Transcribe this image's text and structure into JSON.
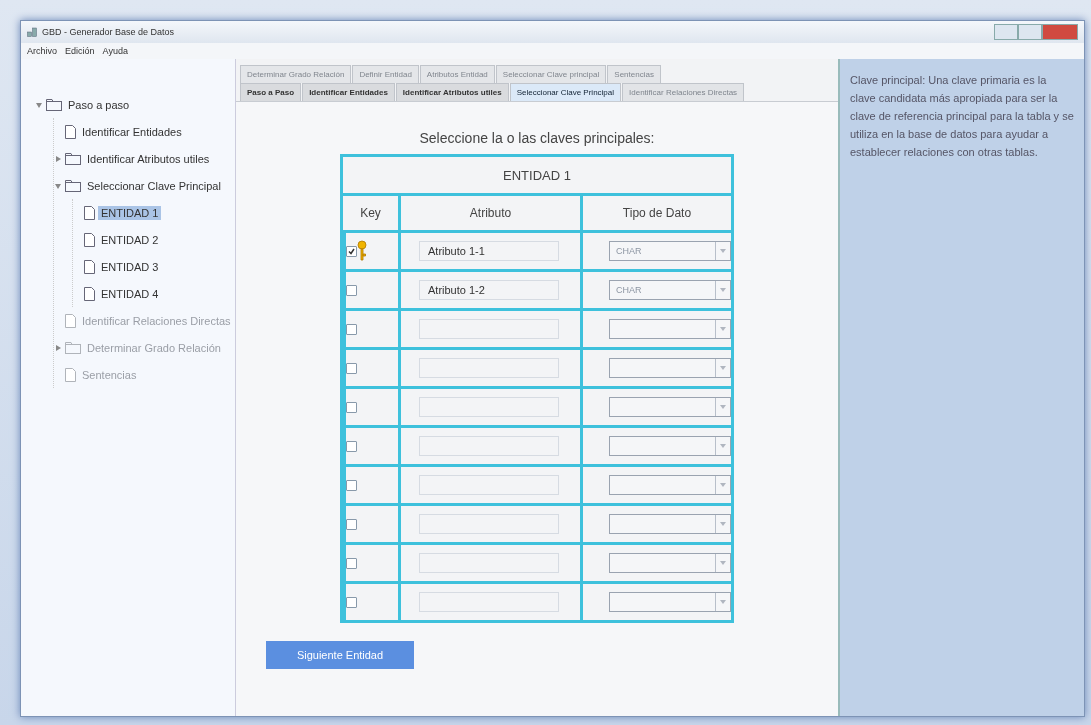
{
  "window": {
    "title": "GBD - Generador Base de Datos"
  },
  "menu": [
    "Archivo",
    "Edición",
    "Ayuda"
  ],
  "tree": [
    {
      "label": "Paso a paso",
      "kind": "folder",
      "expanded": true,
      "selected": false,
      "disabled": false,
      "children": [
        {
          "label": "Identificar Entidades",
          "kind": "file",
          "selected": false,
          "disabled": false
        },
        {
          "label": "Identificar Atributos utiles",
          "kind": "folder",
          "expanded": false,
          "selected": false,
          "disabled": false
        },
        {
          "label": "Seleccionar Clave Principal",
          "kind": "folder",
          "expanded": true,
          "selected": false,
          "disabled": false,
          "children": [
            {
              "label": "ENTIDAD 1",
              "kind": "file",
              "selected": true,
              "disabled": false
            },
            {
              "label": "ENTIDAD 2",
              "kind": "file",
              "selected": false,
              "disabled": false
            },
            {
              "label": "ENTIDAD 3",
              "kind": "file",
              "selected": false,
              "disabled": false
            },
            {
              "label": "ENTIDAD 4",
              "kind": "file",
              "selected": false,
              "disabled": false
            }
          ]
        },
        {
          "label": "Identificar Relaciones Directas",
          "kind": "file",
          "selected": false,
          "disabled": true
        },
        {
          "label": "Determinar Grado Relación",
          "kind": "folder",
          "expanded": false,
          "selected": false,
          "disabled": true
        },
        {
          "label": "Sentencias",
          "kind": "file",
          "selected": false,
          "disabled": true
        }
      ]
    }
  ],
  "tabs_back": [
    {
      "label": "Determinar Grado Relación",
      "disabled": true
    },
    {
      "label": "Definir Entidad",
      "disabled": true
    },
    {
      "label": "Atributos Entidad",
      "disabled": true
    },
    {
      "label": "Seleccionar Clave principal",
      "disabled": true
    },
    {
      "label": "Sentencias",
      "disabled": true
    }
  ],
  "tabs": [
    {
      "label": "Paso a Paso",
      "selected": false,
      "disabled": false
    },
    {
      "label": "Identificar Entidades",
      "selected": false,
      "disabled": false
    },
    {
      "label": "Identificar Atributos utiles",
      "selected": false,
      "disabled": false
    },
    {
      "label": "Seleccionar Clave Principal",
      "selected": true,
      "disabled": false
    },
    {
      "label": "Identificar Relaciones Directas",
      "selected": false,
      "disabled": true
    }
  ],
  "prompt": "Seleccione la o las claves principales:",
  "table": {
    "title": "ENTIDAD 1",
    "columns": [
      "Key",
      "Atributo",
      "Tipo de Dato"
    ],
    "rows": [
      {
        "checked": true,
        "attribute": "Atributo 1-1",
        "type": "CHAR"
      },
      {
        "checked": false,
        "attribute": "Atributo 1-2",
        "type": "CHAR"
      },
      {
        "checked": false
      },
      {
        "checked": false
      },
      {
        "checked": false
      },
      {
        "checked": false
      },
      {
        "checked": false
      },
      {
        "checked": false
      },
      {
        "checked": false
      },
      {
        "checked": false
      }
    ]
  },
  "next_button": "Siguiente Entidad",
  "help": "Clave principal: Una clave primaria es la clave candidata más apropiada para ser la clave de referencia principal para la tabla y se utiliza en la base de datos para ayudar a establecer relaciones con otras tablas."
}
